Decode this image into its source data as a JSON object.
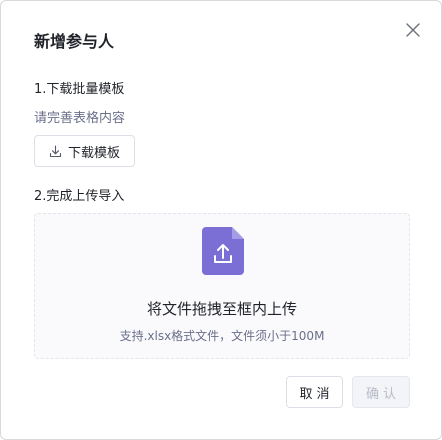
{
  "dialog": {
    "title": "新增参与人",
    "close_icon": "close-icon"
  },
  "step1": {
    "label": "1.下载批量模板",
    "hint": "请完善表格内容",
    "download_button": {
      "icon": "download-icon",
      "label": "下载模板"
    }
  },
  "step2": {
    "label": "2.完成上传导入",
    "dropzone": {
      "icon": "upload-file-icon",
      "title": "将文件拖拽至框内上传",
      "subtitle": "支持.xlsx格式文件，文件须小于100M"
    }
  },
  "footer": {
    "cancel_label": "取消",
    "confirm_label": "确认",
    "confirm_disabled": true
  },
  "colors": {
    "accent": "#7b6fd6",
    "hint_text": "#6b6f8a",
    "disabled_text": "#b9bcc8"
  }
}
